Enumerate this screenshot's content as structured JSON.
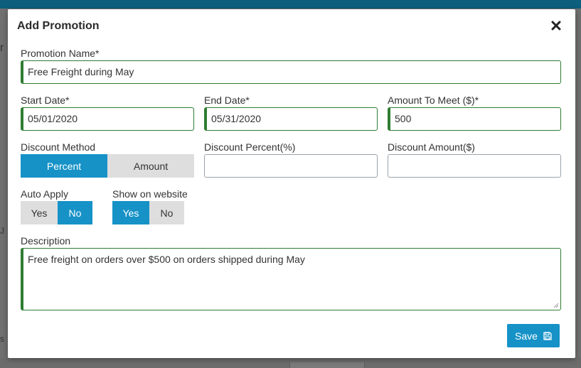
{
  "modal": {
    "title": "Add Promotion"
  },
  "form": {
    "promotion_name": {
      "label": "Promotion Name*",
      "value": "Free Freight during May"
    },
    "start_date": {
      "label": "Start Date*",
      "value": "05/01/2020"
    },
    "end_date": {
      "label": "End Date*",
      "value": "05/31/2020"
    },
    "amount_to_meet": {
      "label": "Amount To Meet ($)*",
      "value": "500"
    },
    "discount_method": {
      "label": "Discount Method",
      "options": [
        "Percent",
        "Amount"
      ],
      "selected": "Percent"
    },
    "discount_percent": {
      "label": "Discount Percent(%)",
      "value": ""
    },
    "discount_amount": {
      "label": "Discount Amount($)",
      "value": ""
    },
    "auto_apply": {
      "label": "Auto Apply",
      "options": [
        "Yes",
        "No"
      ],
      "selected": "No"
    },
    "show_on_website": {
      "label": "Show on website",
      "options": [
        "Yes",
        "No"
      ],
      "selected": "Yes"
    },
    "description": {
      "label": "Description",
      "value": "Free freight on orders over $500 on orders shipped during May"
    }
  },
  "buttons": {
    "save_label": "Save"
  },
  "background": {
    "frag1": "r",
    "frag2": "J",
    "frag3": "s"
  },
  "colors": {
    "accent": "#1692c7",
    "valid_border": "#2e7d32",
    "topbar": "#0d5f7d"
  },
  "icons": {
    "close": "close-icon",
    "save": "floppy-disk-icon"
  }
}
